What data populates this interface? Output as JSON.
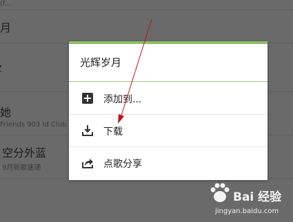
{
  "background_list": {
    "rows": [
      {
        "title": "",
        "subtitle": "(f..."
      },
      {
        "title": "月",
        "subtitle": ""
      },
      {
        "title": "z",
        "subtitle": ""
      },
      {
        "title": "她",
        "subtitle": "Friends 903 Id Club"
      },
      {
        "title": "空分外蓝",
        "subtitle": "9月新歌速递"
      }
    ]
  },
  "dialog": {
    "title": "光辉岁月",
    "items": [
      {
        "label": "添加到...",
        "icon": "plus-box-icon"
      },
      {
        "label": "下载",
        "icon": "download-icon"
      },
      {
        "label": "点歌分享",
        "icon": "share-icon"
      }
    ]
  },
  "watermark": {
    "brand": "Bai 经验",
    "url": "jingyan.baidu.com"
  },
  "colors": {
    "accent": "#8bc064",
    "arrow": "#c0141a",
    "overlay_bg": "#6a6a6a"
  }
}
